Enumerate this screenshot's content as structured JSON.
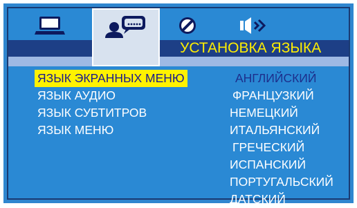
{
  "tabs": [
    {
      "icon": "laptop-icon",
      "active": false
    },
    {
      "icon": "user-chat-icon",
      "active": true
    },
    {
      "icon": "disc-icon",
      "active": false
    },
    {
      "icon": "speaker-icon",
      "active": false
    }
  ],
  "page_title": "УСТАНОВКА ЯЗЫКА",
  "menu_items": [
    {
      "label": "ЯЗЫК ЭКРАННЫХ МЕНЮ",
      "selected": true
    },
    {
      "label": "ЯЗЫК АУДИО",
      "selected": false
    },
    {
      "label": "ЯЗЫК СУБТИТРОВ",
      "selected": false
    },
    {
      "label": "ЯЗЫК МЕНЮ",
      "selected": false
    }
  ],
  "languages": [
    {
      "label": "АНГЛИЙСКИЙ",
      "selected": true
    },
    {
      "label": "ФРАНЦУЗКИЙ",
      "selected": false
    },
    {
      "label": "НЕМЕЦКИЙ",
      "selected": false
    },
    {
      "label": "ИТАЛЬЯНСКИЙ",
      "selected": false
    },
    {
      "label": "ГРЕЧЕСКИЙ",
      "selected": false
    },
    {
      "label": "ИСПАНСКИЙ",
      "selected": false
    },
    {
      "label": "ПОРТУГАЛЬСКИЙ",
      "selected": false
    },
    {
      "label": "ДАТСКИЙ",
      "selected": false
    }
  ],
  "colors": {
    "background": "#2a89d4",
    "title_band": "#1d3f86",
    "highlight": "#fff200",
    "title_text": "#ffee00",
    "selected_language_text": "#1d2f8c"
  }
}
